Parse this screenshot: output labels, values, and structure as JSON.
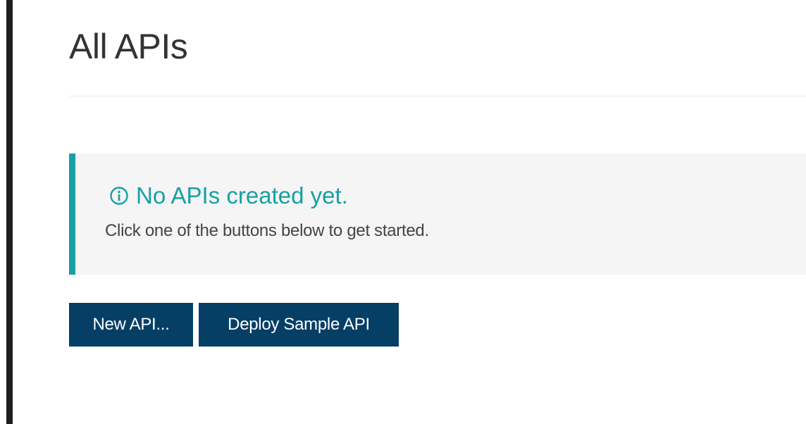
{
  "page": {
    "title": "All APIs"
  },
  "empty_state": {
    "heading": "No APIs created yet.",
    "subtext": "Click one of the buttons below to get started.",
    "icon": "info-icon",
    "accent_color": "#17a0a5"
  },
  "actions": {
    "new_api_label": "New API...",
    "deploy_sample_label": "Deploy Sample API",
    "button_color": "#063f66"
  }
}
